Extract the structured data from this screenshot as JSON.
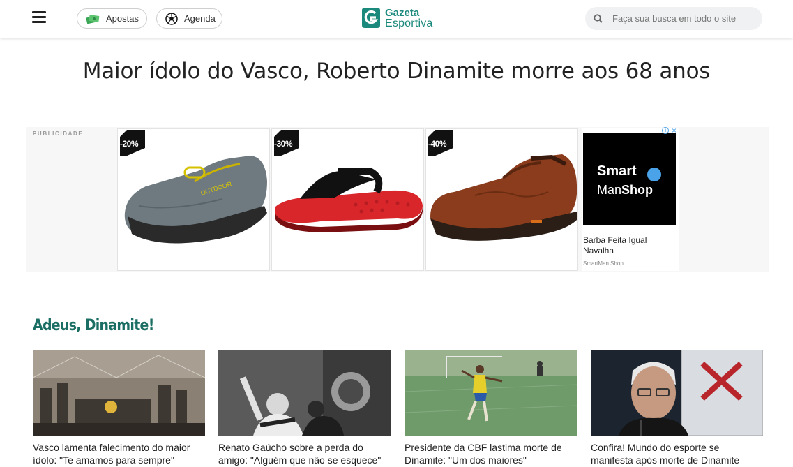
{
  "header": {
    "apostas_label": "Apostas",
    "agenda_label": "Agenda",
    "logo_line1": "Gazeta",
    "logo_line2": "Esportiva",
    "search_placeholder": "Faça sua busca em todo o site"
  },
  "article": {
    "title": "Maior ídolo do Vasco, Roberto Dinamite morre aos 68 anos"
  },
  "ad": {
    "label": "PUBLICIDADE",
    "products": [
      {
        "discount": "-20%",
        "image": "grey-mesh-outdoor-shoe"
      },
      {
        "discount": "-30%",
        "image": "red-black-flip-flop"
      },
      {
        "discount": "-40%",
        "image": "brown-leather-shoe"
      }
    ],
    "sponsor": {
      "logo_word1": "Smart",
      "logo_word2a": "Man",
      "logo_word2b": "Shop",
      "headline": "Barba Feita Igual Navalha",
      "name": "SmartMan Shop"
    },
    "adchoice_icon": "i",
    "close_icon": "×"
  },
  "section": {
    "title": "Adeus, Dinamite!",
    "cards": [
      {
        "text": "Vasco lamenta falecimento do maior ídolo: \"Te amamos para sempre\""
      },
      {
        "text": "Renato Gaúcho sobre a perda do amigo: \"Alguém que não se esquece\""
      },
      {
        "text": "Presidente da CBF lastima morte de Dinamite: \"Um dos maiores\""
      },
      {
        "text": "Confira! Mundo do esporte se manifesta após morte de Dinamite"
      }
    ]
  },
  "colors": {
    "brand": "#1b8a7d",
    "section_title": "#1b6e63",
    "search_bg": "#eff1f2"
  }
}
